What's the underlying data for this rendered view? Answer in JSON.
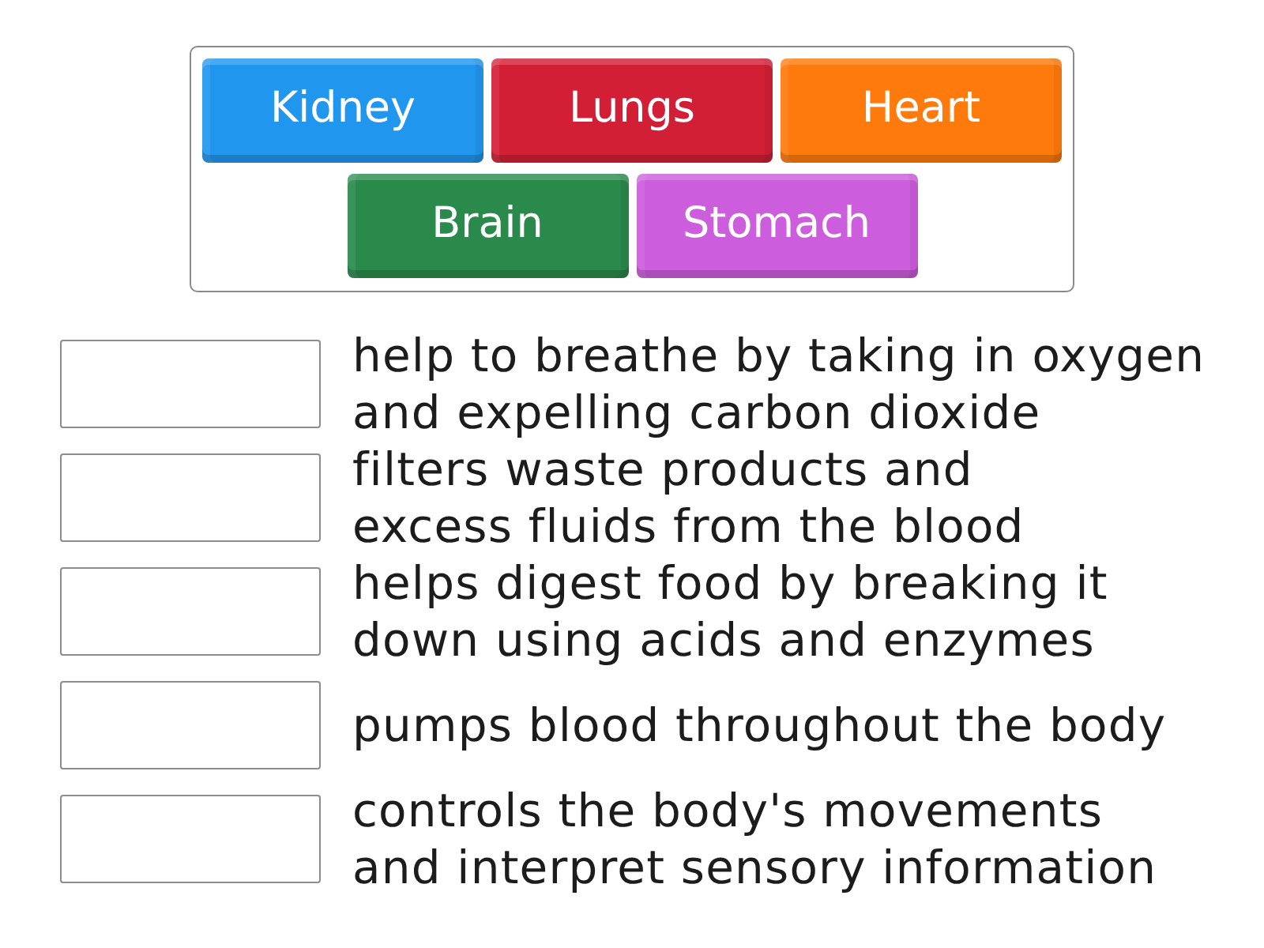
{
  "tiles": [
    {
      "label": "Kidney",
      "color": "#2196ee"
    },
    {
      "label": "Lungs",
      "color": "#d21f36"
    },
    {
      "label": "Heart",
      "color": "#ff7a0c"
    },
    {
      "label": "Brain",
      "color": "#2a8a4c"
    },
    {
      "label": "Stomach",
      "color": "#cc5ddc"
    }
  ],
  "items": [
    {
      "lines": [
        "help to breathe by taking in oxygen",
        "and expelling carbon dioxide"
      ]
    },
    {
      "lines": [
        "filters waste products and",
        "excess fluids from the blood"
      ]
    },
    {
      "lines": [
        "helps digest food by breaking it",
        "down using acids and enzymes"
      ]
    },
    {
      "lines": [
        "pumps blood throughout the body"
      ]
    },
    {
      "lines": [
        "controls the body's movements",
        "and interpret sensory information"
      ]
    }
  ]
}
